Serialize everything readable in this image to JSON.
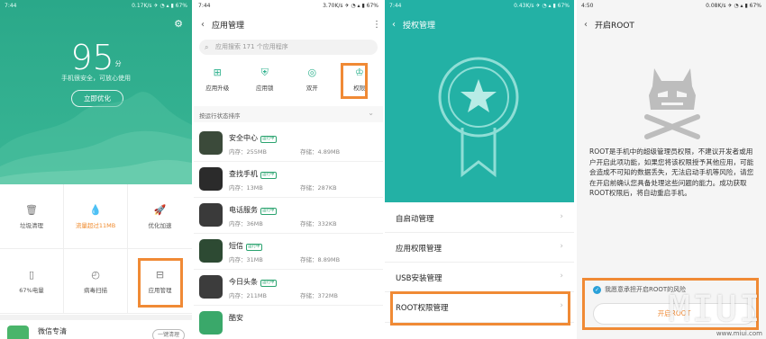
{
  "panel1": {
    "status_time": "7:44",
    "status_right": "0.17K/s ✈ ◔ ▴ ▮ 67%",
    "score": "95",
    "score_unit": "分",
    "status_text": "手机很安全，可放心使用",
    "optimize_button": "立即优化",
    "grid": [
      {
        "label": "垃圾清理",
        "icon": "trash-icon"
      },
      {
        "label": "流量超过11MB",
        "icon": "drop-icon",
        "warn": true
      },
      {
        "label": "优化加速",
        "icon": "rocket-icon"
      },
      {
        "label": "67%电量",
        "icon": "battery-icon"
      },
      {
        "label": "病毒扫描",
        "icon": "shield-scan-icon"
      },
      {
        "label": "应用管理",
        "icon": "app-manage-icon"
      }
    ],
    "bottom_app": "微信专清",
    "bottom_button": "一键清理"
  },
  "panel2": {
    "status_time": "7:44",
    "status_right": "3.70K/s ✈ ◔ ▴ ▮ 67%",
    "title": "应用管理",
    "search_placeholder": "应用搜索 171 个应用程序",
    "quick": [
      {
        "label": "应用升级",
        "icon": "upgrade-icon"
      },
      {
        "label": "应用锁",
        "icon": "lock-icon"
      },
      {
        "label": "双开",
        "icon": "dual-icon"
      },
      {
        "label": "权限",
        "icon": "permission-icon"
      }
    ],
    "sort_label": "按运行状态排序",
    "badge": "运行中",
    "apps": [
      {
        "name": "安全中心",
        "mem": "内存：255MB",
        "sto": "存储：4.89MB",
        "color": "#3b4a3a"
      },
      {
        "name": "查找手机",
        "mem": "内存：13MB",
        "sto": "存储：287KB",
        "color": "#2b2b2b"
      },
      {
        "name": "电话服务",
        "mem": "内存：36MB",
        "sto": "存储：332KB",
        "color": "#3a3a3a"
      },
      {
        "name": "短信",
        "mem": "内存：31MB",
        "sto": "存储：8.89MB",
        "color": "#2d4a33"
      },
      {
        "name": "今日头条",
        "mem": "内存：211MB",
        "sto": "存储：372MB",
        "color": "#3c3c3c"
      },
      {
        "name": "酷安",
        "mem": "",
        "sto": "",
        "color": "#3aa86a"
      }
    ]
  },
  "panel3": {
    "status_time": "7:44",
    "status_right": "0.43K/s ✈ ◔ ▴ ▮ 67%",
    "title": "授权管理",
    "menu": [
      "自启动管理",
      "应用权限管理",
      "USB安装管理",
      "ROOT权限管理"
    ]
  },
  "panel4": {
    "status_time": "4:50",
    "status_right": "0.08K/s ✈ ◔ ▴ ▮ 67%",
    "title": "开启ROOT",
    "description": "ROOT是手机中的超级管理员权限，不建议开发者或用户开启此项功能，如果您将该权限授予其他应用，可能会造成不可知的数据丢失，无法启动手机等风险，请您在开启前确认您具备处理这些问题的能力。成功获取ROOT权限后，将自动重启手机。",
    "agree": "我愿意承担开启ROOT的风险",
    "enable_button": "开启ROOT",
    "watermark": "MIUI",
    "watermark_url": "www.miui.com"
  },
  "colors": {
    "panel1_green": "#2aa889",
    "panel3_teal": "#23b1a5",
    "highlight": "#f08a35",
    "checkbox_blue": "#2aa1d9"
  }
}
